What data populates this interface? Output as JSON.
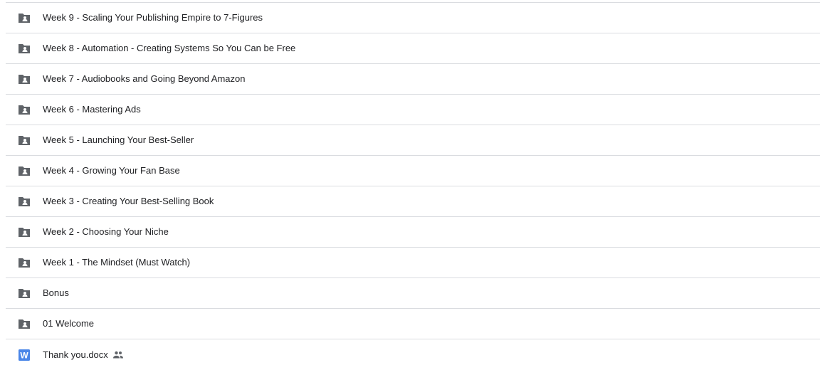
{
  "colors": {
    "folder_icon": "#5f6368",
    "word_icon": "#4a86e8",
    "divider": "#dadce0",
    "text": "#202124"
  },
  "items": [
    {
      "label": "Week 9 - Scaling Your Publishing Empire to 7-Figures",
      "icon": "shared-folder-icon"
    },
    {
      "label": "Week 8 - Automation - Creating Systems So You Can be Free",
      "icon": "shared-folder-icon"
    },
    {
      "label": "Week 7 - Audiobooks and Going Beyond Amazon",
      "icon": "shared-folder-icon"
    },
    {
      "label": "Week 6 - Mastering Ads",
      "icon": "shared-folder-icon"
    },
    {
      "label": "Week 5 - Launching Your Best-Seller",
      "icon": "shared-folder-icon"
    },
    {
      "label": "Week 4 - Growing Your Fan Base",
      "icon": "shared-folder-icon"
    },
    {
      "label": "Week 3 - Creating Your Best-Selling Book",
      "icon": "shared-folder-icon"
    },
    {
      "label": "Week 2 - Choosing Your Niche",
      "icon": "shared-folder-icon"
    },
    {
      "label": "Week 1 - The Mindset (Must Watch)",
      "icon": "shared-folder-icon"
    },
    {
      "label": "Bonus",
      "icon": "shared-folder-icon"
    },
    {
      "label": "01 Welcome",
      "icon": "shared-folder-icon"
    },
    {
      "label": "Thank you.docx",
      "icon": "word-doc-icon",
      "word_icon_letter": "W",
      "shared_icon": "people-icon"
    }
  ]
}
